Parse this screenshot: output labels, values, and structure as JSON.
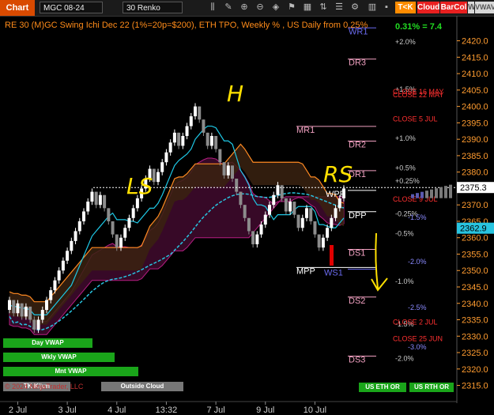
{
  "toolbar": {
    "app_button": "Chart",
    "symbol": "MGC 08-24",
    "interval": "30 Renko",
    "brand_tk": "T<K",
    "cloud": "Cloud",
    "barcol": "BarCol",
    "w": "W",
    "vwave": "VWAVE"
  },
  "caption": "RE 30 (M)GC Swing Ichi Dec 22 (1%=20p=$200), ETH TPO, Weekly % , US Daily from 0.25%",
  "pct_head": "0.31% = 7.4",
  "chart_data": {
    "type": "line",
    "ylim": [
      2312,
      2424
    ],
    "y_ticks": [
      2315.0,
      2320.0,
      2325.0,
      2330.0,
      2335.0,
      2340.0,
      2345.0,
      2350.0,
      2355.0,
      2360.0,
      2365.0,
      2370.0,
      2375.0,
      2380.0,
      2385.0,
      2390.0,
      2395.0,
      2400.0,
      2405.0,
      2410.0,
      2415.0,
      2420.0
    ],
    "x_tick_labels": [
      "2 Jul",
      "3 Jul",
      "4 Jul",
      "13:32",
      "7 Jul",
      "9 Jul",
      "10 Jul"
    ],
    "last_price": "2375.3",
    "vwap_price": "2362.9",
    "ohlc": [
      [
        2338,
        2342,
        2337,
        2341
      ],
      [
        2341,
        2341,
        2336,
        2337
      ],
      [
        2337,
        2341,
        2336,
        2340
      ],
      [
        2340,
        2340,
        2335,
        2336
      ],
      [
        2336,
        2340,
        2335,
        2339
      ],
      [
        2339,
        2339,
        2334,
        2335
      ],
      [
        2335,
        2336,
        2331,
        2332
      ],
      [
        2332,
        2336,
        2331,
        2335
      ],
      [
        2335,
        2339,
        2334,
        2338
      ],
      [
        2338,
        2342,
        2337,
        2341
      ],
      [
        2341,
        2345,
        2340,
        2344
      ],
      [
        2344,
        2348,
        2343,
        2347
      ],
      [
        2347,
        2351,
        2346,
        2350
      ],
      [
        2350,
        2354,
        2349,
        2353
      ],
      [
        2353,
        2357,
        2352,
        2356
      ],
      [
        2356,
        2360,
        2355,
        2359
      ],
      [
        2359,
        2363,
        2358,
        2362
      ],
      [
        2362,
        2366,
        2361,
        2365
      ],
      [
        2365,
        2369,
        2364,
        2368
      ],
      [
        2368,
        2372,
        2367,
        2371
      ],
      [
        2371,
        2375,
        2370,
        2374
      ],
      [
        2374,
        2374,
        2369,
        2370
      ],
      [
        2370,
        2374,
        2369,
        2373
      ],
      [
        2373,
        2373,
        2368,
        2369
      ],
      [
        2369,
        2369,
        2364,
        2365
      ],
      [
        2365,
        2365,
        2360,
        2361
      ],
      [
        2361,
        2361,
        2356,
        2357
      ],
      [
        2357,
        2361,
        2356,
        2360
      ],
      [
        2360,
        2364,
        2359,
        2363
      ],
      [
        2363,
        2367,
        2362,
        2366
      ],
      [
        2366,
        2370,
        2365,
        2369
      ],
      [
        2369,
        2373,
        2368,
        2372
      ],
      [
        2372,
        2376,
        2371,
        2375
      ],
      [
        2375,
        2379,
        2374,
        2378
      ],
      [
        2378,
        2382,
        2377,
        2381
      ],
      [
        2381,
        2381,
        2376,
        2377
      ],
      [
        2377,
        2381,
        2376,
        2380
      ],
      [
        2380,
        2384,
        2379,
        2383
      ],
      [
        2383,
        2387,
        2382,
        2386
      ],
      [
        2386,
        2390,
        2385,
        2389
      ],
      [
        2389,
        2393,
        2388,
        2392
      ],
      [
        2392,
        2392,
        2387,
        2388
      ],
      [
        2388,
        2392,
        2387,
        2391
      ],
      [
        2391,
        2395,
        2390,
        2394
      ],
      [
        2394,
        2398,
        2393,
        2397
      ],
      [
        2397,
        2401,
        2396,
        2400
      ],
      [
        2400,
        2400,
        2395,
        2396
      ],
      [
        2396,
        2396,
        2391,
        2392
      ],
      [
        2392,
        2392,
        2387,
        2388
      ],
      [
        2388,
        2392,
        2387,
        2391
      ],
      [
        2391,
        2391,
        2386,
        2387
      ],
      [
        2387,
        2387,
        2382,
        2383
      ],
      [
        2383,
        2383,
        2378,
        2379
      ],
      [
        2379,
        2383,
        2378,
        2382
      ],
      [
        2382,
        2382,
        2377,
        2378
      ],
      [
        2378,
        2378,
        2373,
        2374
      ],
      [
        2374,
        2374,
        2369,
        2370
      ],
      [
        2370,
        2370,
        2365,
        2366
      ],
      [
        2366,
        2366,
        2361,
        2362
      ],
      [
        2362,
        2362,
        2357,
        2358
      ],
      [
        2358,
        2362,
        2357,
        2361
      ],
      [
        2361,
        2365,
        2360,
        2364
      ],
      [
        2364,
        2368,
        2363,
        2367
      ],
      [
        2367,
        2371,
        2366,
        2370
      ],
      [
        2370,
        2374,
        2369,
        2373
      ],
      [
        2373,
        2377,
        2372,
        2376
      ],
      [
        2376,
        2376,
        2371,
        2372
      ],
      [
        2372,
        2372,
        2367,
        2368
      ],
      [
        2368,
        2372,
        2367,
        2371
      ],
      [
        2371,
        2371,
        2366,
        2367
      ],
      [
        2367,
        2367,
        2362,
        2363
      ],
      [
        2363,
        2367,
        2362,
        2366
      ],
      [
        2366,
        2370,
        2365,
        2369
      ],
      [
        2369,
        2369,
        2364,
        2365
      ],
      [
        2365,
        2365,
        2360,
        2361
      ],
      [
        2361,
        2361,
        2356,
        2357
      ],
      [
        2357,
        2361,
        2356,
        2360
      ],
      [
        2360,
        2364,
        2359,
        2363
      ],
      [
        2363,
        2367,
        2362,
        2366
      ],
      [
        2366,
        2370,
        2365,
        2369
      ],
      [
        2369,
        2373,
        2368,
        2372
      ],
      [
        2372,
        2376,
        2371,
        2375
      ]
    ],
    "price_lines": [
      {
        "label": "WR1",
        "price": 2422.0,
        "color": "#6a6aee"
      },
      {
        "label": "DR3",
        "price": 2412.5,
        "color": "#f0a0c0"
      },
      {
        "label": "MR1",
        "price": 2392.0,
        "color": "#f0a0c0"
      },
      {
        "label": "DR2",
        "price": 2387.5,
        "color": "#f0a0c0"
      },
      {
        "label": "DR1",
        "price": 2378.5,
        "color": "#f0a0c0"
      },
      {
        "label": "WPP",
        "price": 2372.5,
        "color": "#ffffff"
      },
      {
        "label": "DPP",
        "price": 2366.0,
        "color": "#ffffff"
      },
      {
        "label": "DS1",
        "price": 2354.5,
        "color": "#f0a0c0"
      },
      {
        "label": "MPP",
        "price": 2349.0,
        "color": "#ffffff"
      },
      {
        "label": "WS1",
        "price": 2348.5,
        "color": "#6a6aee"
      },
      {
        "label": "DS2",
        "price": 2340.0,
        "color": "#f0a0c0"
      },
      {
        "label": "DS3",
        "price": 2322.0,
        "color": "#f0a0c0"
      }
    ],
    "pct_labels": [
      {
        "text": "+2.0%",
        "price": 2419.0,
        "color": "#cccccc"
      },
      {
        "text": "+1.5%",
        "price": 2404.5,
        "color": "#cccccc"
      },
      {
        "text": "+1.0%",
        "price": 2389.5,
        "color": "#cccccc"
      },
      {
        "text": "+0.5%",
        "price": 2380.5,
        "color": "#cccccc"
      },
      {
        "text": "+0.25%",
        "price": 2376.5,
        "color": "#cccccc"
      },
      {
        "text": "-0.25%",
        "price": 2366.5,
        "color": "#cccccc"
      },
      {
        "text": "-1.5%",
        "price": 2365.5,
        "color": "#8a8aff"
      },
      {
        "text": "-0.5%",
        "price": 2360.5,
        "color": "#cccccc"
      },
      {
        "text": "-2.0%",
        "price": 2352.0,
        "color": "#8a8aff"
      },
      {
        "text": "-1.0%",
        "price": 2346.0,
        "color": "#cccccc"
      },
      {
        "text": "-2.5%",
        "price": 2338.0,
        "color": "#8a8aff"
      },
      {
        "text": "-1.5%",
        "price": 2333.0,
        "color": "#cccccc"
      },
      {
        "text": "-3.0%",
        "price": 2326.0,
        "color": "#8a8aff"
      },
      {
        "text": "-2.0%",
        "price": 2322.5,
        "color": "#cccccc"
      }
    ],
    "close_labels": [
      {
        "text": "CLOSE 16 MAY",
        "price": 2403.8
      },
      {
        "text": "CLOSE 22 MAY",
        "price": 2402.8
      },
      {
        "text": "CLOSE 5 JUL",
        "price": 2395.5
      },
      {
        "text": "CLOSE 9 JUL",
        "price": 2371.0
      },
      {
        "text": "CLOSE 2 JUL",
        "price": 2333.5
      },
      {
        "text": "CLOSE 25 JUN",
        "price": 2328.5
      }
    ],
    "annotations": {
      "ls": "LS",
      "h": "H",
      "rs": "RS"
    },
    "colors": {
      "axis_text": "#ff9c30",
      "close_text": "#ff3030",
      "cloud_up": "#d07a22",
      "cloud_down": "#c0208a",
      "tenkan": "#1ec8e6",
      "kijun": "#ff8a22",
      "vwap_day": "#28c4e0",
      "bull_renko": "#ffffff",
      "bear_renko": "#8c8c8c"
    }
  },
  "vwap_buttons": {
    "day": "Day VWAP",
    "weekly": "Wkly VWAP",
    "monthly": "Mnt VWAP",
    "tk": "TK Kijun",
    "outside": "Outside Cloud"
  },
  "bottom_buttons": {
    "eth": "US ETH OR",
    "rth": "US RTH OR"
  },
  "copyright": "© 2024 NinjaTrader, LLC"
}
